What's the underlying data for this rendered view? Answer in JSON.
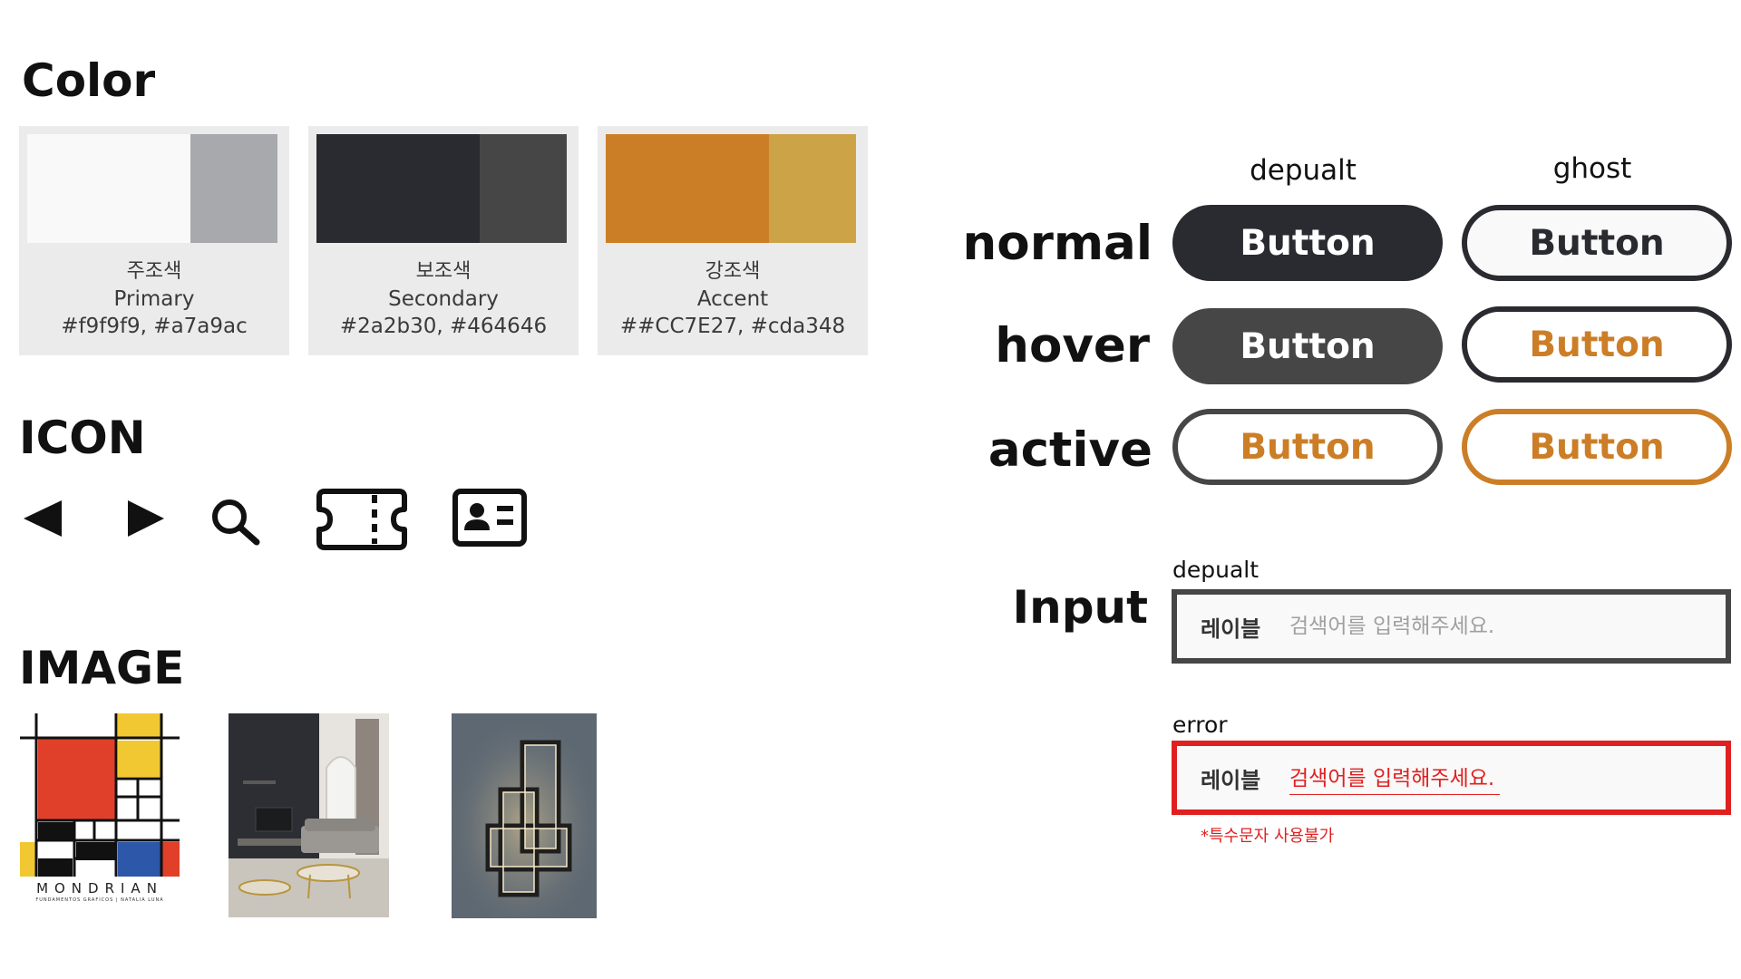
{
  "sections": {
    "color_title": "Color",
    "icon_title": "ICON",
    "image_title": "IMAGE"
  },
  "colors": [
    {
      "korean": "주조색",
      "name": "Primary",
      "codes": "#f9f9f9, #a7a9ac",
      "main": "#f9f9f9",
      "sub": "#a7a9ac"
    },
    {
      "korean": "보조색",
      "name": "Secondary",
      "codes": "#2a2b30, #464646",
      "main": "#2a2b30",
      "sub": "#464646"
    },
    {
      "korean": "강조색",
      "name": "Accent",
      "codes": "##CC7E27, #cda348",
      "main": "#cc7e27",
      "sub": "#cda348"
    }
  ],
  "icons": [
    "arrow-left-icon",
    "arrow-right-icon",
    "search-icon",
    "ticket-icon",
    "id-card-icon"
  ],
  "images": {
    "mondrian_caption": "MONDRIAN",
    "mondrian_subcaption": "FUNDAMENTOS GRAFICOS | NATALIA LUNA"
  },
  "buttons": {
    "column_default": "depualt",
    "column_ghost": "ghost",
    "states": {
      "normal": "normal",
      "hover": "hover",
      "active": "active"
    },
    "label": "Button"
  },
  "input": {
    "section_label": "Input",
    "default_title": "depualt",
    "error_title": "error",
    "field_label": "레이블",
    "placeholder": "검색어를 입력해주세요.",
    "error_value": "검색어를 입력해주세요.",
    "error_message": "*특수문자 사용불가"
  },
  "palette": {
    "dark": "#2a2b30",
    "dark_hover": "#464646",
    "accent": "#cc7e27",
    "error": "#e02020"
  }
}
